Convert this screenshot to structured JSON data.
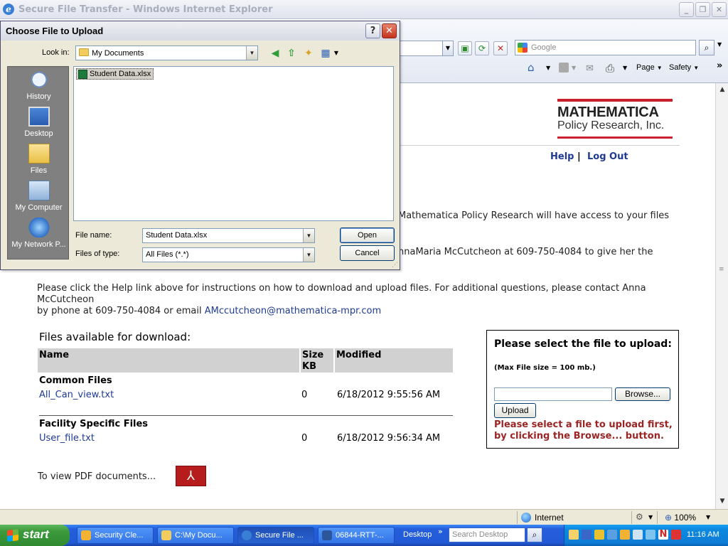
{
  "ie": {
    "title": "Secure File Transfer - Windows Internet Explorer",
    "search_placeholder": "Google",
    "commands": {
      "page": "Page",
      "safety": "Safety"
    },
    "statusbar": {
      "zone": "Internet",
      "zoom": "100%"
    }
  },
  "dialog": {
    "title": "Choose File to Upload",
    "look_in_label": "Look in:",
    "look_in_value": "My Documents",
    "places": [
      "History",
      "Desktop",
      "Files",
      "My Computer",
      "My Network P..."
    ],
    "files": [
      "Student Data.xlsx"
    ],
    "filename_label": "File name:",
    "filename_value": "Student Data.xlsx",
    "filetype_label": "Files of type:",
    "filetype_value": "All Files (*.*)",
    "open_button": "Open",
    "cancel_button": "Cancel"
  },
  "page": {
    "logo_name": "MATHEMATICA",
    "logo_sub": "Policy Research, Inc.",
    "help_link": "Help",
    "separator": "|",
    "logout_link": "Log Out",
    "intro_line1_partial": "Mathematica Policy Research will have access to your files",
    "intro_line2_partial": "nnaMaria McCutcheon at 609-750-4084 to give her the",
    "help_para": "Please click the Help link above for instructions on how to download and upload files.  For additional questions, please contact Anna McCutcheon",
    "help_para_line2": "by phone at 609-750-4084 or email",
    "email": "AMccutcheon@mathematica-mpr.com",
    "files_heading": "Files available for download:",
    "table_headers": {
      "name": "Name",
      "size": "Size KB",
      "modified": "Modified"
    },
    "groups": [
      {
        "title": "Common Files",
        "file": "All_Can_view.txt",
        "size": "0",
        "modified": "6/18/2012 9:55:56 AM"
      },
      {
        "title": "Facility Specific Files",
        "file": "User_file.txt",
        "size": "0",
        "modified": "6/18/2012 9:56:34 AM"
      }
    ],
    "pdf_text": "To view PDF documents...",
    "upload_title": "Please select the file to upload:",
    "upload_max": "(Max File size = 100 mb.)",
    "browse_button": "Browse...",
    "upload_button": "Upload",
    "upload_warning": "Please select a file to upload first, by clicking the Browse... button."
  },
  "taskbar": {
    "start": "start",
    "tasks": [
      "Security Cle...",
      "C:\\My Docu...",
      "Secure File ...",
      "06844-RTT-..."
    ],
    "desktop": "Desktop",
    "search_placeholder": "Search Desktop",
    "clock": "11:16 AM"
  },
  "colors": {
    "link": "#1f3a93",
    "warning": "#9b2424",
    "logo_red": "#c8202f",
    "table_header_bg": "#d1d1d1"
  }
}
